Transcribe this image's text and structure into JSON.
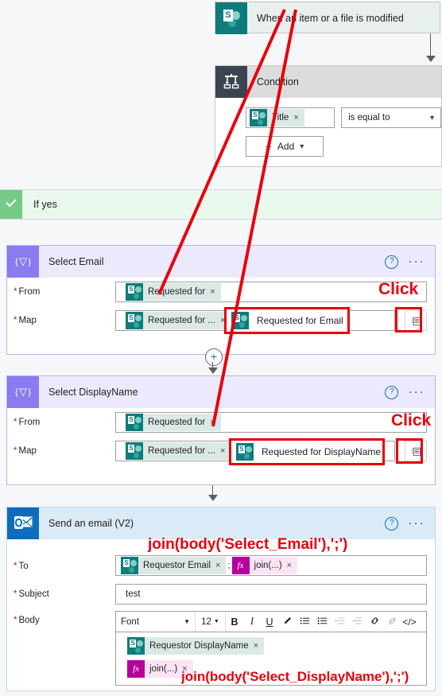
{
  "trigger": {
    "title": "When an item or a file is modified",
    "icon": "sharepoint-icon"
  },
  "condition": {
    "title": "Condition",
    "icon": "condition-icon",
    "left_token": "Title",
    "operator": "is equal to",
    "add_label": "Add",
    "token_remove": "×"
  },
  "if_yes": {
    "label": "If yes",
    "icon": "check-icon"
  },
  "select_email": {
    "title": "Select Email",
    "icon": "select-action-icon",
    "help_glyph": "?",
    "more_glyph": "···",
    "from_label": "From",
    "from_token": "Requested for",
    "map_label": "Map",
    "map_token": "Requested for ...",
    "token_remove": "×",
    "callout_text": "Requested for Email",
    "click_label": "Click",
    "grid_icon": "switch-to-text-mode-icon"
  },
  "select_displayname": {
    "title": "Select DisplayName",
    "icon": "select-action-icon",
    "help_glyph": "?",
    "more_glyph": "···",
    "from_label": "From",
    "from_token": "Requested for",
    "map_label": "Map",
    "map_token": "Requested for ...",
    "token_remove": "×",
    "callout_text": "Requested for DisplayName",
    "click_label": "Click",
    "grid_icon": "switch-to-text-mode-icon"
  },
  "send_email": {
    "title": "Send an email (V2)",
    "icon": "outlook-icon",
    "help_glyph": "?",
    "more_glyph": "···",
    "to_label": "To",
    "to_token_sp": "Requestor Email",
    "to_separator": ";",
    "to_token_fx": "join(...)",
    "fx_badge": "fx",
    "subject_label": "Subject",
    "subject_value": "test",
    "body_label": "Body",
    "token_remove": "×",
    "body_token_sp": "Requestor DisplayName",
    "body_token_fx": "join(...)",
    "toolbar": {
      "font_label": "Font",
      "font_caret": "▼",
      "size_label": "12",
      "size_caret": "▼",
      "bold": "B",
      "italic": "I",
      "underline": "U",
      "highlight": "✐",
      "numbered_list": "≣",
      "bulleted_list": "≡",
      "indent": "→≡",
      "outdent": "≡←",
      "link": "🔗",
      "unlink": "⛓",
      "code": "</>"
    }
  },
  "annotations": {
    "join_email": "join(body('Select_Email'),';')",
    "join_displayname": "join(body('Select_DisplayName'),';')",
    "accent_red": "#e8000d",
    "accent_purple": "#8b7bf0",
    "accent_teal": "#0e7c7b",
    "accent_blue": "#0f6cbd",
    "accent_green": "#76ca88"
  }
}
